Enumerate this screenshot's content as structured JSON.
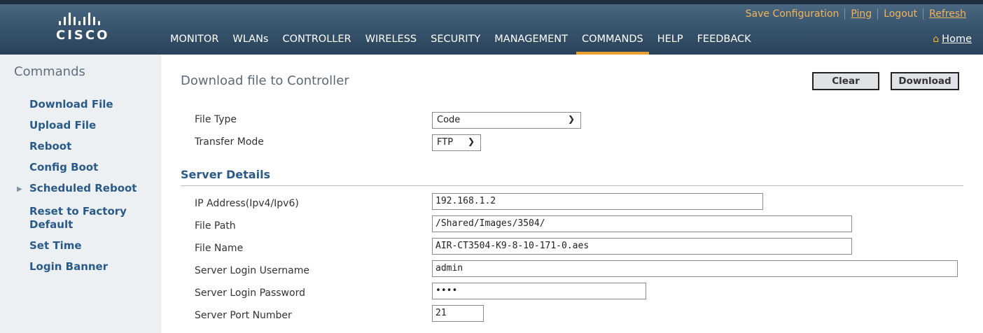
{
  "header": {
    "logo_text": "CISCO",
    "top_links": [
      "Save Configuration",
      "Ping",
      "Logout",
      "Refresh"
    ],
    "nav": [
      "MONITOR",
      "WLANs",
      "CONTROLLER",
      "WIRELESS",
      "SECURITY",
      "MANAGEMENT",
      "COMMANDS",
      "HELP",
      "FEEDBACK"
    ],
    "active_nav": "COMMANDS",
    "home_label": "Home",
    "accent_color": "#e8a030"
  },
  "sidebar": {
    "title": "Commands",
    "items": [
      "Download File",
      "Upload File",
      "Reboot",
      "Config Boot",
      "Scheduled Reboot",
      "Reset to Factory",
      "Default",
      "Set Time",
      "Login Banner"
    ]
  },
  "main": {
    "title": "Download file to Controller",
    "clear_label": "Clear",
    "download_label": "Download",
    "file_type_label": "File Type",
    "file_type_value": "Code",
    "transfer_mode_label": "Transfer Mode",
    "transfer_mode_value": "FTP",
    "server_details_title": "Server Details",
    "ip_label": "IP Address(Ipv4/Ipv6)",
    "ip_value": "192.168.1.2",
    "path_label": "File Path",
    "path_value": "/Shared/Images/3504/",
    "name_label": "File Name",
    "name_value": "AIR-CT3504-K9-8-10-171-0.aes",
    "user_label": "Server Login Username",
    "user_value": "admin",
    "pass_label": "Server Login Password",
    "pass_value": "••••",
    "port_label": "Server Port Number",
    "port_value": "21"
  }
}
